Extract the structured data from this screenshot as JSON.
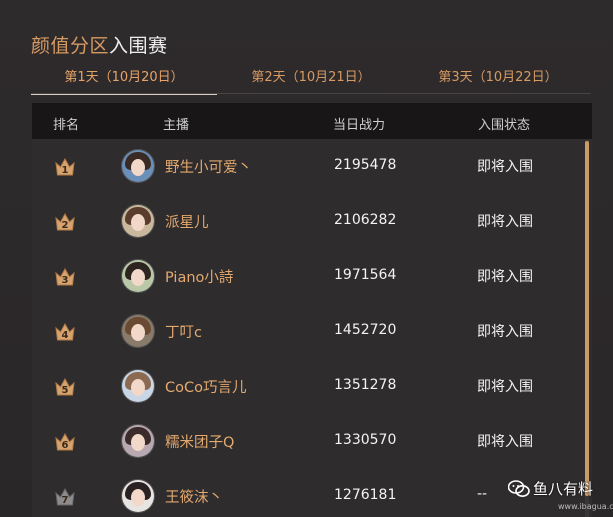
{
  "header": {
    "title_part1": "颜值分区",
    "title_part2": "入围赛"
  },
  "tabs": [
    {
      "label": "第1天（10月20日）",
      "active": true
    },
    {
      "label": "第2天（10月21日）",
      "active": false
    },
    {
      "label": "第3天（10月22日）",
      "active": false
    }
  ],
  "table": {
    "columns": [
      "排名",
      "主播",
      "当日战力",
      "入围状态"
    ],
    "rows": [
      {
        "rank": "1",
        "name": "野生小可爱丶",
        "power": "2195478",
        "status": "即将入围"
      },
      {
        "rank": "2",
        "name": "派星儿",
        "power": "2106282",
        "status": "即将入围"
      },
      {
        "rank": "3",
        "name": "Piano小詩",
        "power": "1971564",
        "status": "即将入围"
      },
      {
        "rank": "4",
        "name": "丁叮c",
        "power": "1452720",
        "status": "即将入围"
      },
      {
        "rank": "5",
        "name": "CoCo巧言儿",
        "power": "1351278",
        "status": "即将入围"
      },
      {
        "rank": "6",
        "name": "糯米团子Q",
        "power": "1330570",
        "status": "即将入围"
      },
      {
        "rank": "7",
        "name": "王筱沫丶",
        "power": "1276181",
        "status": "--"
      }
    ]
  },
  "watermark": {
    "text": "鱼八有料",
    "url": "www.ibagua.com.cn"
  },
  "colors": {
    "accent": "#d79a63",
    "background": "#2b2829",
    "header_bg": "#181617",
    "crown_gold": "#d6a36e",
    "crown_gray": "#8c8c8c"
  }
}
